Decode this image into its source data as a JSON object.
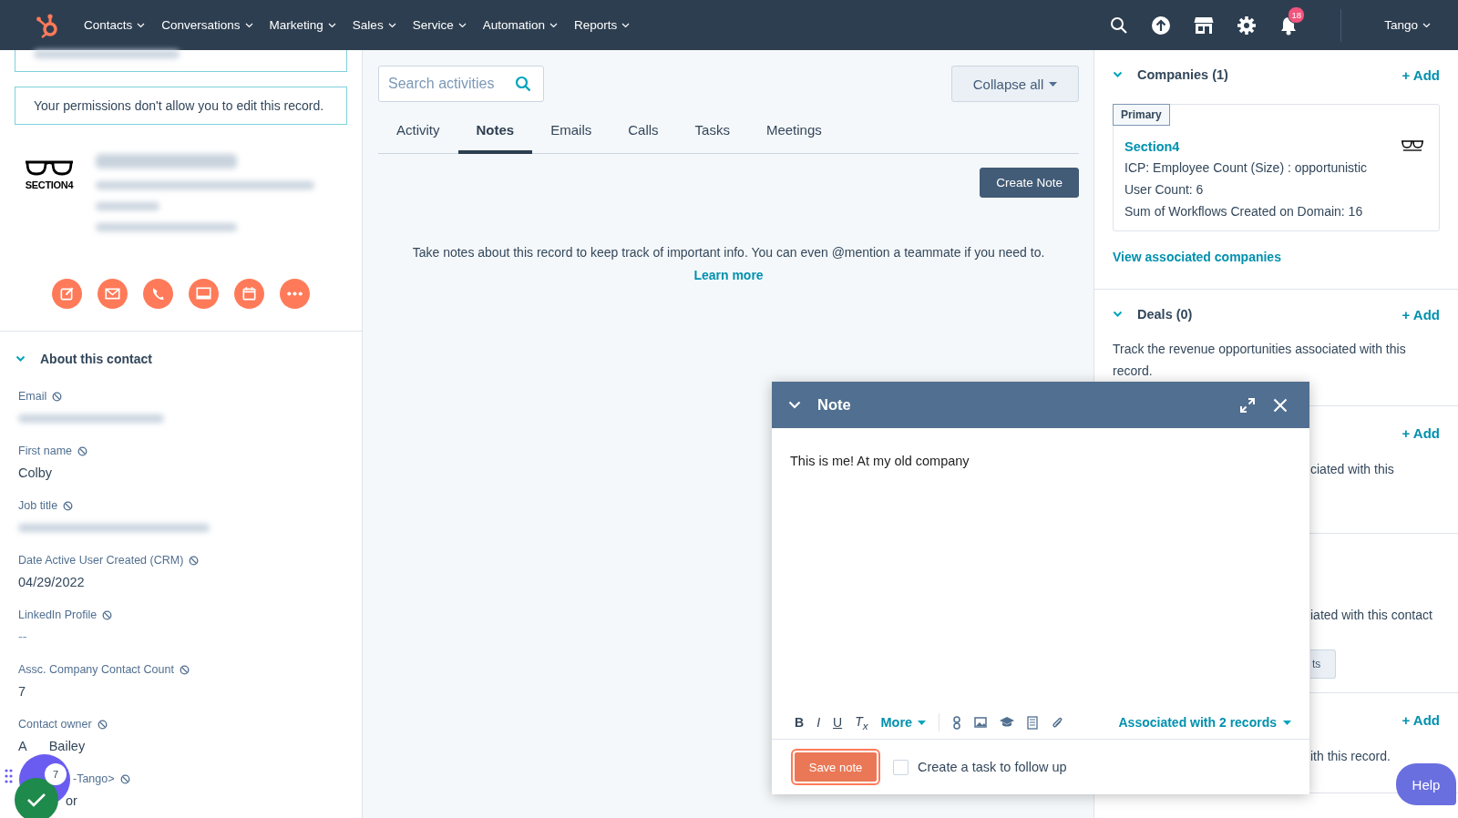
{
  "nav": {
    "items": [
      "Contacts",
      "Conversations",
      "Marketing",
      "Sales",
      "Service",
      "Automation",
      "Reports"
    ],
    "notification_count": "18",
    "user": "Tango"
  },
  "left_panel": {
    "notice": "Your permissions don't allow you to edit this record.",
    "logo_text": "SECTION4",
    "section": {
      "title": "About this contact",
      "expanded": true
    },
    "fields": [
      {
        "label": "Email",
        "kind": "blurred"
      },
      {
        "label": "First name",
        "kind": "text",
        "value": "Colby"
      },
      {
        "label": "Job title",
        "kind": "blurred"
      },
      {
        "label": "Date Active User Created (CRM)",
        "kind": "text",
        "value": "04/29/2022"
      },
      {
        "label": "LinkedIn Profile",
        "kind": "empty",
        "value": "--"
      },
      {
        "label": "Assc. Company Contact Count",
        "kind": "text",
        "value": "7"
      },
      {
        "label": "Contact owner",
        "kind": "split",
        "parts": [
          "A",
          "Bailey"
        ]
      },
      {
        "label": "-Tango>",
        "kind": "covered",
        "value": "or"
      }
    ]
  },
  "floating_widget": {
    "badge": "7"
  },
  "activities": {
    "search": {
      "placeholder": "Search activities"
    },
    "collapse_button": "Collapse all",
    "tabs": [
      {
        "label": "Activity",
        "selected": false
      },
      {
        "label": "Notes",
        "selected": true
      },
      {
        "label": "Emails",
        "selected": false
      },
      {
        "label": "Calls",
        "selected": false
      },
      {
        "label": "Tasks",
        "selected": false
      },
      {
        "label": "Meetings",
        "selected": false
      }
    ],
    "create_button": "Create Note",
    "empty_text": "Take notes about this record to keep track of important info. You can even @mention a teammate if you need to.",
    "learn_more": "Learn more"
  },
  "right_panel": {
    "companies": {
      "title": "Companies (1)",
      "expanded": true,
      "add": "+ Add",
      "tag": "Primary",
      "name": "Section4",
      "lines": [
        "ICP: Employee Count (Size) : opportunistic",
        "User Count: 6",
        "Sum of Workflows Created on Domain: 16"
      ],
      "link": "View associated companies"
    },
    "deals": {
      "title": "Deals (0)",
      "expanded": true,
      "add": "+ Add",
      "text": "Track the revenue opportunities associated with this record."
    },
    "partial_sections": [
      {
        "add": "+ Add",
        "text": "ciated with this"
      },
      {
        "text": "iated with this contact",
        "button": "ts"
      },
      {
        "add": "+ Add",
        "text": "ith this record."
      }
    ]
  },
  "help_button": "Help",
  "note_modal": {
    "title": "Note",
    "expanded": true,
    "body": "This is me! At my old company",
    "format_buttons": [
      "B",
      "I",
      "U",
      "T$_{x}$"
    ],
    "more": "More",
    "associated": "Associated with 2 records",
    "save": "Save note",
    "follow_up": {
      "label": "Create a task to follow up",
      "checked": false
    }
  }
}
